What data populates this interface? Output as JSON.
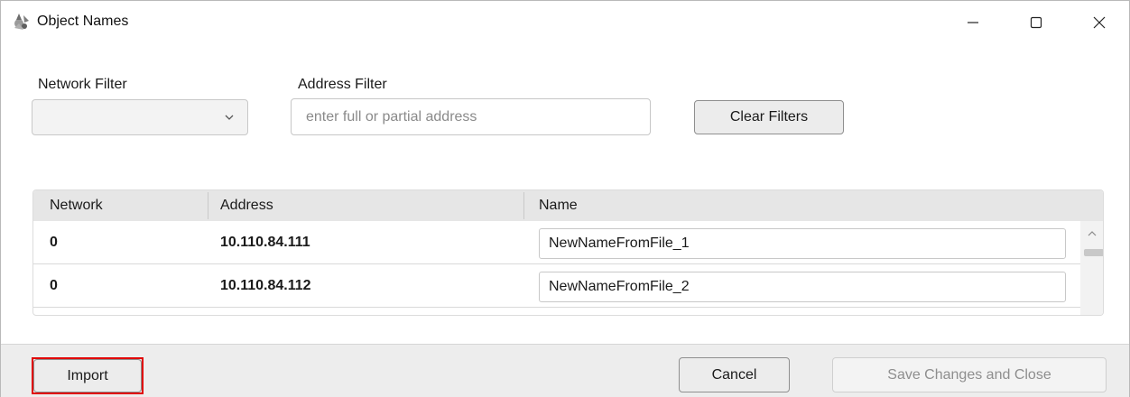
{
  "window": {
    "title": "Object Names",
    "controls": {
      "minimize": "—",
      "maximize": "☐",
      "close": "✕"
    }
  },
  "filters": {
    "network_label": "Network Filter",
    "network_selected": "",
    "address_label": "Address Filter",
    "address_value": "",
    "address_placeholder": "enter full or partial address",
    "clear_label": "Clear Filters"
  },
  "grid": {
    "columns": [
      "Network",
      "Address",
      "Name"
    ],
    "rows": [
      {
        "network": "0",
        "address": "10.110.84.111",
        "name": "NewNameFromFile_1"
      },
      {
        "network": "0",
        "address": "10.110.84.112",
        "name": "NewNameFromFile_2"
      }
    ]
  },
  "footer": {
    "import_label": "Import",
    "cancel_label": "Cancel",
    "save_label": "Save Changes and Close"
  },
  "colors": {
    "highlight": "#e00000",
    "header_bg": "#e6e6e6",
    "footer_bg": "#ededed"
  }
}
